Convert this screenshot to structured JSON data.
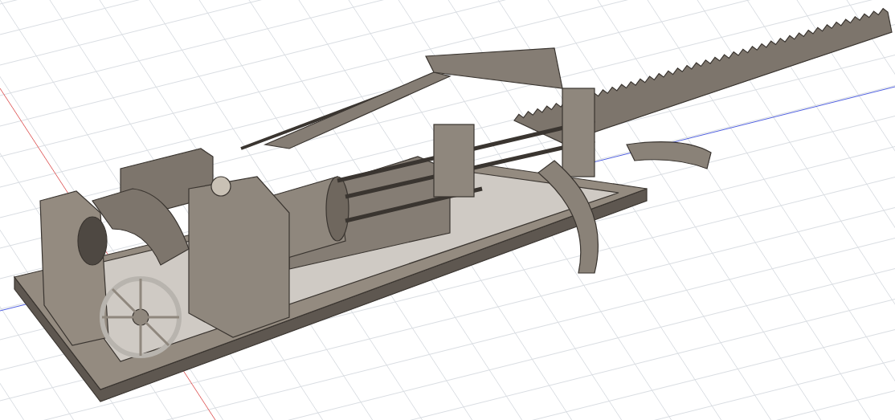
{
  "viewport": {
    "grid_visible": true,
    "axes": [
      {
        "kind": "x",
        "color": "#e06060"
      },
      {
        "kind": "y",
        "color": "#5060e0"
      }
    ]
  }
}
